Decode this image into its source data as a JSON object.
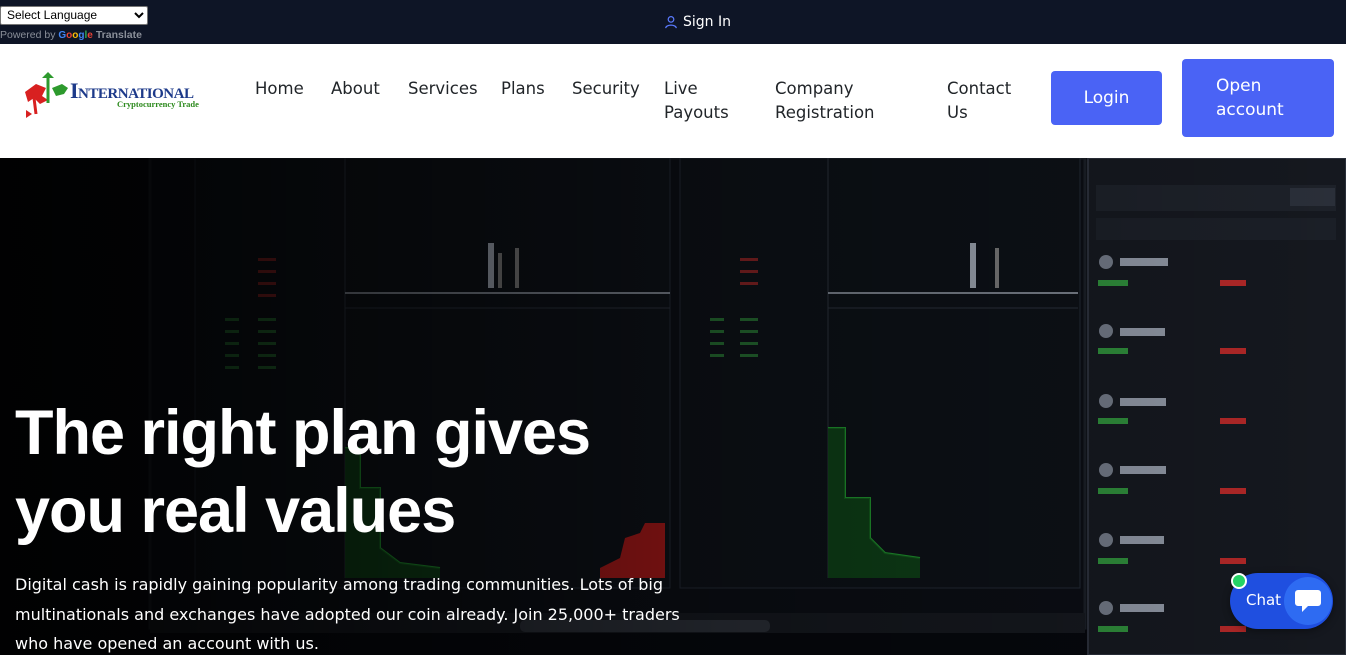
{
  "topbar": {
    "language_select": {
      "selected": "Select Language"
    },
    "powered_by": "Powered by",
    "google": "Google",
    "translate": "Translate",
    "signin_label": "Sign In"
  },
  "logo": {
    "title": "International",
    "subtitle": "Cryptocurrency Trade"
  },
  "nav": {
    "items": [
      {
        "label": "Home"
      },
      {
        "label": "About"
      },
      {
        "label": "Services"
      },
      {
        "label": "Plans"
      },
      {
        "label": "Security"
      },
      {
        "label": "Live Payouts"
      },
      {
        "label": "Company Registration"
      },
      {
        "label": "Contact Us"
      }
    ],
    "login_label": "Login",
    "open_account_label": "Open account"
  },
  "hero": {
    "title": "The right plan gives you real values",
    "text": "Digital cash is rapidly gaining popularity among trading communities. Lots of big multinationals and exchanges have adopted our coin already. Join 25,000+ traders who have opened an account with us."
  },
  "chat": {
    "label": "Chat"
  },
  "colors": {
    "accent": "#4a63f5",
    "topbar": "#0e1526",
    "chat": "#1f4fe0",
    "online": "#25d366"
  }
}
